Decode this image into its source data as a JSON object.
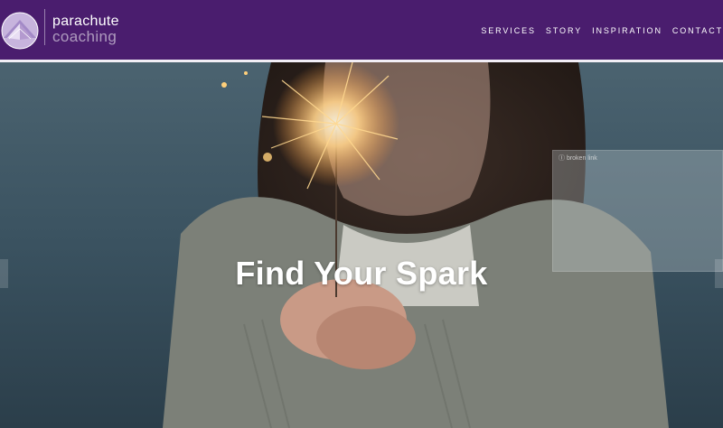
{
  "header": {
    "logo": {
      "line1": "parachute",
      "line2": "coaching"
    },
    "nav": [
      {
        "label": "SERVICES"
      },
      {
        "label": "STORY"
      },
      {
        "label": "INSPIRATION"
      },
      {
        "label": "CONTACT"
      }
    ]
  },
  "hero": {
    "title": "Find Your Spark",
    "broken_image_text": "Ⓘ broken link"
  },
  "colors": {
    "header_bg": "#4a1d6e",
    "hero_bg": "#3a4f5c",
    "spark": "#ffd28a"
  }
}
